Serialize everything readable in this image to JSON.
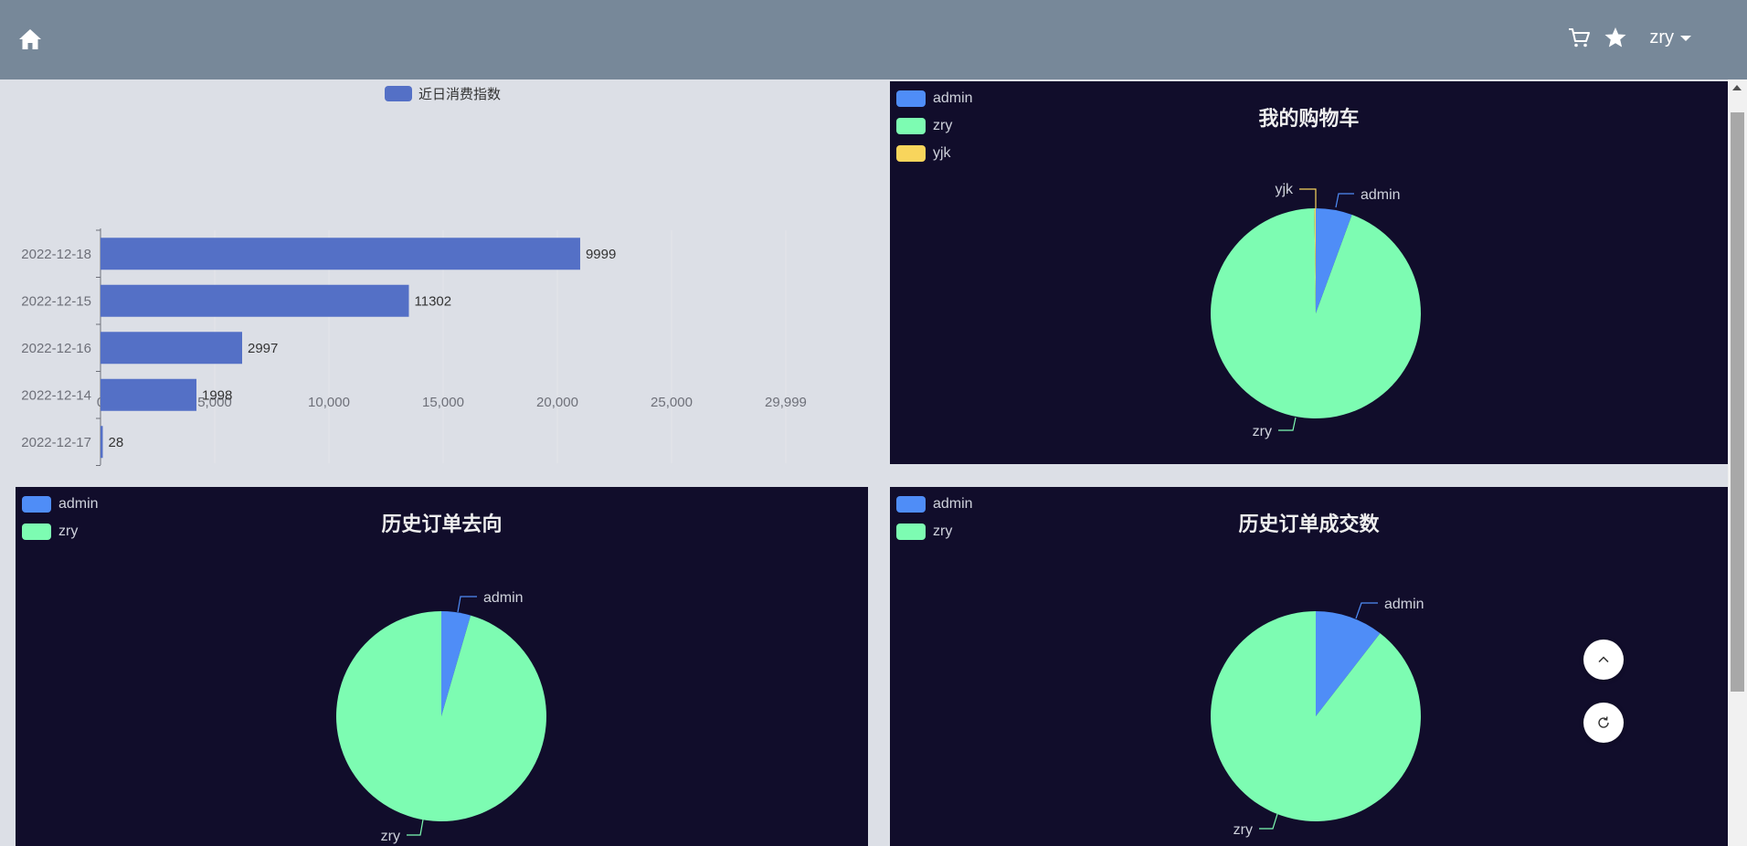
{
  "header": {
    "home_icon": "home-icon",
    "cart_icon": "cart-icon",
    "star_icon": "star-icon",
    "user_name": "zry",
    "dropdown_icon": "caret-down-icon",
    "bg_color": "#778899"
  },
  "bar_chart": {
    "legend": "近日消费指数",
    "color": "#5470c6"
  },
  "panels": {
    "cart": {
      "title": "我的购物车",
      "legend": [
        "admin",
        "zry",
        "yjk"
      ]
    },
    "orders_direction": {
      "title": "历史订单去向",
      "legend": [
        "admin",
        "zry"
      ]
    },
    "orders_deals": {
      "title": "历史订单成交数",
      "legend": [
        "admin",
        "zry"
      ]
    }
  },
  "colors": {
    "admin": "#4f8df7",
    "zry": "#7dfcb2",
    "yjk": "#f8d55c",
    "panel_bg": "#110d2b"
  },
  "chart_data": [
    {
      "type": "bar",
      "orientation": "horizontal",
      "categories": [
        "2022-12-18",
        "2022-12-15",
        "2022-12-16",
        "2022-12-14",
        "2022-12-17"
      ],
      "values": [
        9999,
        11302,
        2997,
        1998,
        28
      ],
      "bar_lengths": [
        20999,
        13500,
        6200,
        4200,
        100
      ],
      "series": [
        {
          "name": "近日消费指数",
          "values": [
            9999,
            11302,
            2997,
            1998,
            28
          ]
        }
      ],
      "xticks": [
        "0",
        "5,000",
        "10,000",
        "15,000",
        "20,000",
        "25,000",
        "29,999"
      ],
      "xlim": [
        0,
        29999
      ],
      "grid": true,
      "legend_position": "top-center"
    },
    {
      "type": "pie",
      "title": "我的购物车",
      "labels": [
        "admin",
        "zry",
        "yjk"
      ],
      "values": [
        5.6,
        94.2,
        0.2
      ],
      "legend_position": "top-left"
    },
    {
      "type": "pie",
      "title": "历史订单去向",
      "labels": [
        "admin",
        "zry"
      ],
      "values": [
        4.5,
        95.5
      ],
      "legend_position": "top-left"
    },
    {
      "type": "pie",
      "title": "历史订单成交数",
      "labels": [
        "admin",
        "zry"
      ],
      "values": [
        10.5,
        89.5
      ],
      "legend_position": "top-left"
    }
  ]
}
